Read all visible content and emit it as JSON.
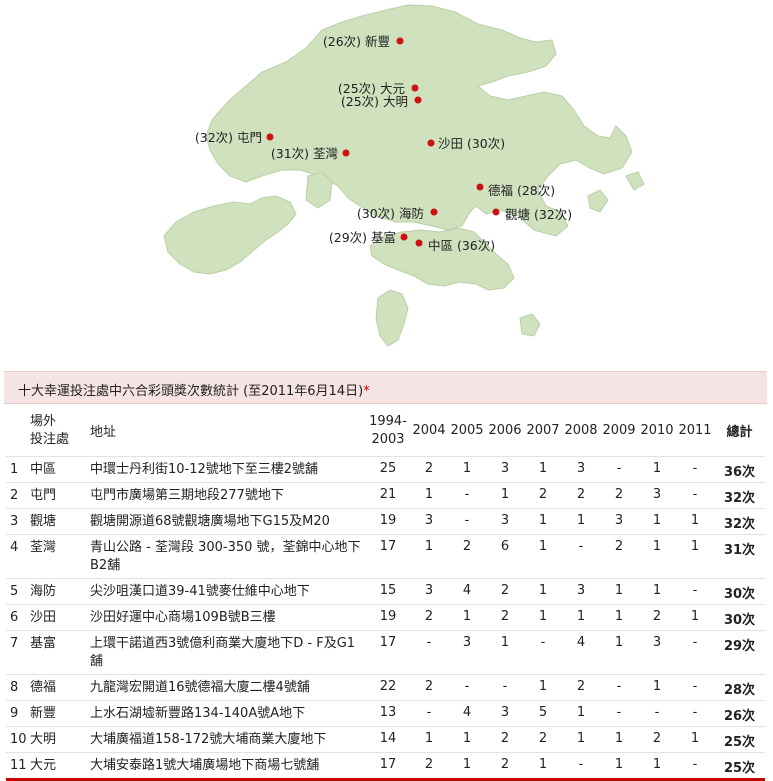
{
  "map": {
    "colors": {
      "land": "#cfe1bd",
      "land_stroke": "#b9d0a6",
      "marker": "#cc1111"
    },
    "markers": [
      {
        "label": "(26次) 新豐"
      },
      {
        "label": "(25次) 大元"
      },
      {
        "label": "(25次) 大明"
      },
      {
        "label": "(32次) 屯門"
      },
      {
        "label": "(31次) 荃灣"
      },
      {
        "label": "沙田 (30次)"
      },
      {
        "label": "德福 (28次)"
      },
      {
        "label": "(30次) 海防"
      },
      {
        "label": "觀塘 (32次)"
      },
      {
        "label": "(29次) 基富"
      },
      {
        "label": "中區 (36次)"
      }
    ]
  },
  "table": {
    "title": "十大幸運投注處中六合彩頭獎次數統計 (至2011年6月14日)",
    "title_mark": "*",
    "headers": {
      "outlet_line1": "場外",
      "outlet_line2": "投注處",
      "address": "地址",
      "y1_line1": "1994-",
      "y1_line2": "2003",
      "years": [
        "2004",
        "2005",
        "2006",
        "2007",
        "2008",
        "2009",
        "2010",
        "2011"
      ],
      "total": "總計"
    },
    "rows": [
      {
        "rank": "1",
        "name": "中區",
        "address": "中環士丹利街10-12號地下至三樓2號舖",
        "y1": "25",
        "years": [
          "2",
          "1",
          "3",
          "1",
          "3",
          "-",
          "1",
          "-"
        ],
        "total": "36次"
      },
      {
        "rank": "2",
        "name": "屯門",
        "address": "屯門市廣場第三期地段277號地下",
        "y1": "21",
        "years": [
          "1",
          "-",
          "1",
          "2",
          "2",
          "2",
          "3",
          "-"
        ],
        "total": "32次"
      },
      {
        "rank": "3",
        "name": "觀塘",
        "address": "觀塘開源道68號觀塘廣場地下G15及M20",
        "y1": "19",
        "years": [
          "3",
          "-",
          "3",
          "1",
          "1",
          "3",
          "1",
          "1"
        ],
        "total": "32次"
      },
      {
        "rank": "4",
        "name": "荃灣",
        "address": "青山公路 - 荃灣段 300-350 號，荃錦中心地下B2舖",
        "y1": "17",
        "years": [
          "1",
          "2",
          "6",
          "1",
          "-",
          "2",
          "1",
          "1"
        ],
        "total": "31次"
      },
      {
        "rank": "5",
        "name": "海防",
        "address": "尖沙咀漢口道39-41號麥仕維中心地下",
        "y1": "15",
        "years": [
          "3",
          "4",
          "2",
          "1",
          "3",
          "1",
          "1",
          "-"
        ],
        "total": "30次"
      },
      {
        "rank": "6",
        "name": "沙田",
        "address": "沙田好運中心商場109B號B三樓",
        "y1": "19",
        "years": [
          "2",
          "1",
          "2",
          "1",
          "1",
          "1",
          "2",
          "1"
        ],
        "total": "30次"
      },
      {
        "rank": "7",
        "name": "基富",
        "address": "上環干諾道西3號億利商業大廈地下D - F及G1舖",
        "y1": "17",
        "years": [
          "-",
          "3",
          "1",
          "-",
          "4",
          "1",
          "3",
          "-"
        ],
        "total": "29次"
      },
      {
        "rank": "8",
        "name": "德福",
        "address": "九龍灣宏開道16號德福大廈二樓4號舖",
        "y1": "22",
        "years": [
          "2",
          "-",
          "-",
          "1",
          "2",
          "-",
          "1",
          "-"
        ],
        "total": "28次"
      },
      {
        "rank": "9",
        "name": "新豐",
        "address": "上水石湖墟新豐路134-140A號A地下",
        "y1": "13",
        "years": [
          "-",
          "4",
          "3",
          "5",
          "1",
          "-",
          "-",
          "-"
        ],
        "total": "26次"
      },
      {
        "rank": "10",
        "name": "大明",
        "address": "大埔廣福道158-172號大埔商業大廈地下",
        "y1": "14",
        "years": [
          "1",
          "1",
          "2",
          "2",
          "1",
          "1",
          "2",
          "1"
        ],
        "total": "25次"
      },
      {
        "rank": "11",
        "name": "大元",
        "address": "大埔安泰路1號大埔廣場地下商場七號舖",
        "y1": "17",
        "years": [
          "2",
          "1",
          "2",
          "1",
          "-",
          "1",
          "1",
          "-"
        ],
        "total": "25次"
      }
    ]
  }
}
